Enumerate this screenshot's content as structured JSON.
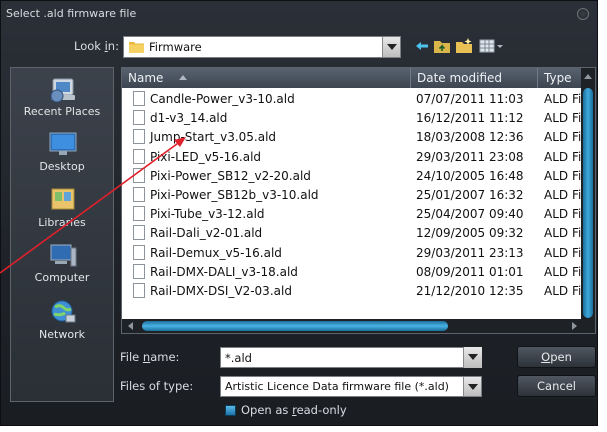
{
  "window": {
    "title": "Select .ald firmware file"
  },
  "lookin": {
    "label_pre": "Look ",
    "label_u": "i",
    "label_post": "n:",
    "value": "Firmware"
  },
  "places": [
    {
      "label": "Recent Places",
      "icon": "recent-places-icon"
    },
    {
      "label": "Desktop",
      "icon": "desktop-icon"
    },
    {
      "label": "Libraries",
      "icon": "libraries-icon"
    },
    {
      "label": "Computer",
      "icon": "computer-icon"
    },
    {
      "label": "Network",
      "icon": "network-icon"
    }
  ],
  "columns": {
    "name": "Name",
    "date": "Date modified",
    "type": "Type"
  },
  "files": [
    {
      "name": "Candle-Power_v3-10.ald",
      "date": "07/07/2011 11:03",
      "type": "ALD Fi"
    },
    {
      "name": "d1-v3_14.ald",
      "date": "16/12/2011 11:12",
      "type": "ALD Fi"
    },
    {
      "name": "Jump-Start_v3.05.ald",
      "date": "18/03/2008 12:36",
      "type": "ALD Fi"
    },
    {
      "name": "Pixi-LED_v5-16.ald",
      "date": "29/03/2011 23:08",
      "type": "ALD Fi"
    },
    {
      "name": "Pixi-Power_SB12_v2-20.ald",
      "date": "24/10/2005 16:48",
      "type": "ALD Fi"
    },
    {
      "name": "Pixi-Power_SB12b_v3-10.ald",
      "date": "25/01/2007 16:32",
      "type": "ALD Fi"
    },
    {
      "name": "Pixi-Tube_v3-12.ald",
      "date": "25/04/2007 09:40",
      "type": "ALD Fi"
    },
    {
      "name": "Rail-Dali_v2-01.ald",
      "date": "12/09/2005 09:32",
      "type": "ALD Fi"
    },
    {
      "name": "Rail-Demux_v5-16.ald",
      "date": "29/03/2011 23:13",
      "type": "ALD Fi"
    },
    {
      "name": "Rail-DMX-DALI_v3-18.ald",
      "date": "08/09/2011 01:01",
      "type": "ALD Fi"
    },
    {
      "name": "Rail-DMX-DSI_V2-03.ald",
      "date": "21/12/2010 12:35",
      "type": "ALD Fi"
    }
  ],
  "filename": {
    "label_pre": "File ",
    "label_u": "n",
    "label_post": "ame:",
    "value": "*.ald"
  },
  "filetype": {
    "label": "Files of type:",
    "value": "Artistic Licence Data firmware file (*.ald)"
  },
  "buttons": {
    "open_u": "O",
    "open_rest": "pen",
    "cancel": "Cancel"
  },
  "readonly": {
    "label_pre": "Open as ",
    "label_u": "r",
    "label_post": "ead-only"
  },
  "colors": {
    "accent": "#3fa9dd",
    "annotation": "#e0202a"
  }
}
